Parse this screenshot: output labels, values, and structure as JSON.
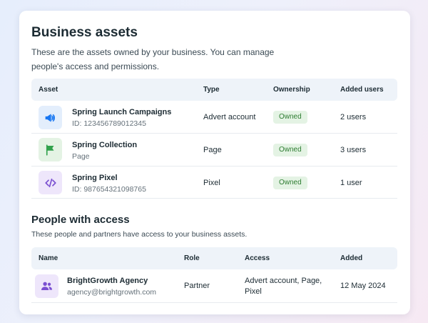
{
  "header": {
    "title": "Business assets",
    "description": "These are the assets owned by your business. You can manage people's access and permissions."
  },
  "assets_table": {
    "columns": [
      "Asset",
      "Type",
      "Ownership",
      "Added users"
    ],
    "rows": [
      {
        "name": "Spring Launch Campaigns",
        "sub": "ID: 123456789012345",
        "type": "Advert account",
        "ownership": "Owned",
        "added_users": "2 users",
        "icon": "megaphone-icon",
        "icon_bg": "#e3eefc",
        "icon_color": "#1877f2"
      },
      {
        "name": "Spring Collection",
        "sub": "Page",
        "type": "Page",
        "ownership": "Owned",
        "added_users": "3 users",
        "icon": "flag-icon",
        "icon_bg": "#e4f3e4",
        "icon_color": "#31a24c"
      },
      {
        "name": "Spring Pixel",
        "sub": "ID: 987654321098765",
        "type": "Pixel",
        "ownership": "Owned",
        "added_users": "1 user",
        "icon": "code-icon",
        "icon_bg": "#eee6fb",
        "icon_color": "#7a4fd1"
      }
    ]
  },
  "people_section": {
    "title": "People with access",
    "description": "These people and partners have access to your business assets."
  },
  "people_table": {
    "columns": [
      "Name",
      "Role",
      "Access",
      "Added"
    ],
    "rows": [
      {
        "name": "BrightGrowth Agency",
        "email": "agency@brightgrowth.com",
        "role": "Partner",
        "access_line1": "Advert account, Page,",
        "access_line2": "Pixel",
        "added": "12 May 2024",
        "icon": "people-icon",
        "icon_bg": "#eee6fb",
        "icon_color": "#7a4fd1"
      }
    ]
  },
  "colors": {
    "owned_badge_bg": "#e4f3e4",
    "owned_badge_text": "#2e7d32",
    "table_header_bg": "#eef3f9"
  }
}
